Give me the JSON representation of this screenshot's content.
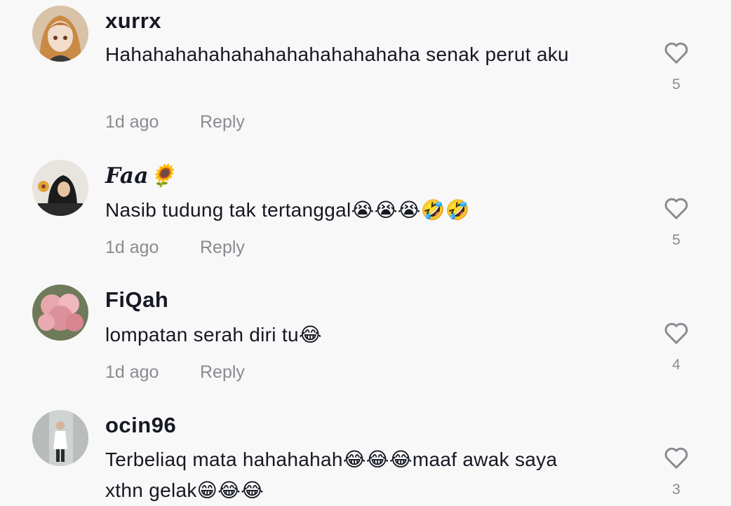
{
  "comments": [
    {
      "username": "xurrx",
      "text": "Hahahahahahahahahahahahahaha senak perut aku",
      "time": "1d ago",
      "reply": "Reply",
      "likes": "5",
      "avatar": "anime-girl-avatar"
    },
    {
      "username": "Faa🌻",
      "text": "Nasib tudung tak tertanggal😭😭😭🤣🤣",
      "time": "1d ago",
      "reply": "Reply",
      "likes": "5",
      "avatar": "hijab-woman-avatar"
    },
    {
      "username": "FiQah",
      "text": "lompatan serah diri tu😂",
      "time": "1d ago",
      "reply": "Reply",
      "likes": "4",
      "avatar": "pink-flowers-avatar"
    },
    {
      "username": "ocin96",
      "text": "Terbeliaq mata hahahahah😂😂😂maaf awak saya xthn gelak😁😂😂",
      "time": "",
      "reply": "",
      "likes": "3",
      "avatar": "standing-person-avatar"
    }
  ],
  "icons": {
    "like": "heart-outline-icon"
  },
  "colors": {
    "text": "#161823",
    "muted": "#8a8b91",
    "background": "#f8f8f8"
  }
}
